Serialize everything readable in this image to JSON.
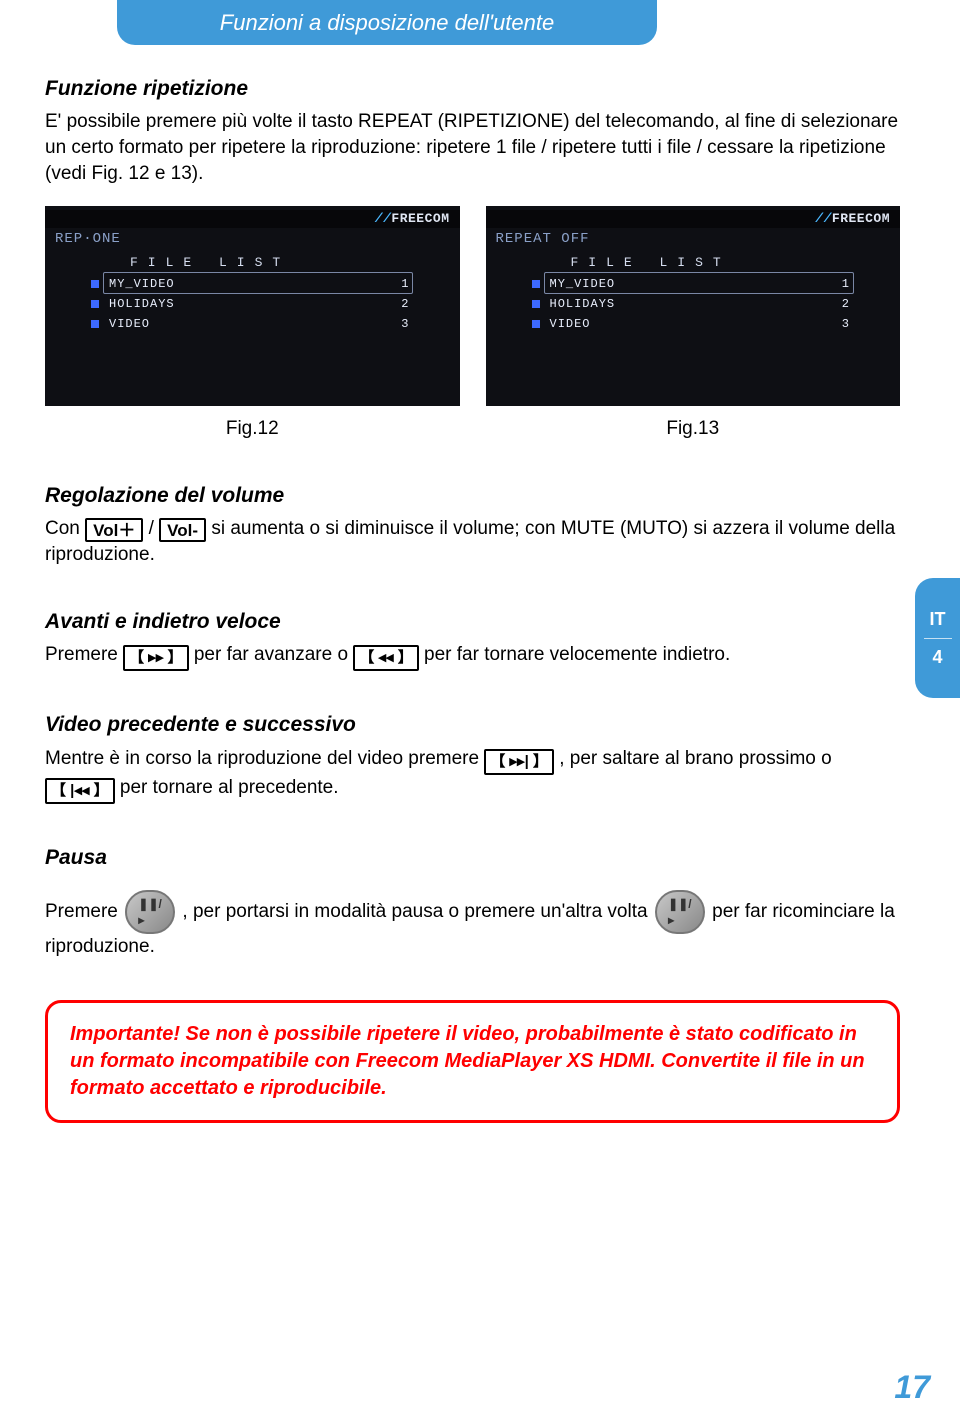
{
  "header": {
    "title": "Funzioni a disposizione dell'utente"
  },
  "sidetab": {
    "lang": "IT",
    "chapter": "4"
  },
  "sec1": {
    "heading": "Funzione ripetizione",
    "body": "E' possibile premere più volte il tasto REPEAT (RIPETIZIONE) del telecomando, al fine di selezionare un certo formato per ripetere la riproduzione: ripetere 1 file / ripetere tutti i file / cessare la ripetizione (vedi Fig. 12 e 13)."
  },
  "freecom_logo_prefix": "//",
  "freecom_logo_text": "FREECOM",
  "screen12": {
    "mode": "REP·ONE",
    "list_label": "FILE    LIST",
    "rows": [
      {
        "name": "MY_VIDEO",
        "num": "1"
      },
      {
        "name": "HOLIDAYS",
        "num": "2"
      },
      {
        "name": "VIDEO",
        "num": "3"
      }
    ],
    "caption": "Fig.12"
  },
  "screen13": {
    "mode": "REPEAT OFF",
    "list_label": "FILE    LIST",
    "rows": [
      {
        "name": "MY_VIDEO",
        "num": "1"
      },
      {
        "name": "HOLIDAYS",
        "num": "2"
      },
      {
        "name": "VIDEO",
        "num": "3"
      }
    ],
    "caption": "Fig.13"
  },
  "sec2": {
    "heading": "Regolazione del volume",
    "pre": "Con ",
    "volplus": "Vol＋",
    "mid1": " / ",
    "volminus": "Vol-",
    "post": " si aumenta o si diminuisce il volume; con MUTE (MUTO) si azzera il volume della riproduzione."
  },
  "sec3": {
    "heading": "Avanti e indietro veloce",
    "pre": "Premere ",
    "ff": "【 ▸▸ 】",
    "mid1": " per far avanzare o ",
    "rw": "【 ◂◂ 】",
    "post": " per far tornare velocemente indietro."
  },
  "sec4": {
    "heading": "Video precedente e successivo",
    "pre": "Mentre è in corso la riproduzione del video premere ",
    "next": "【 ▸▸| 】",
    "mid1": ", per saltare al brano prossimo o ",
    "prev": "【 |◂◂ 】",
    "post": " per tornare al precedente."
  },
  "sec5": {
    "heading": "Pausa",
    "pre": "Premere ",
    "pause_symbol": "❚❚/▸",
    "mid1": ", per portarsi in modalità pausa o premere un'altra volta ",
    "post": " per far ricominciare la riproduzione."
  },
  "important": {
    "title": "Importante!",
    "body": " Se non è possibile ripetere il video, probabilmente è stato codificato in un formato incompatibile con Freecom MediaPlayer XS HDMI. Convertite il file in un formato accettato e riproducibile."
  },
  "page_number": "17"
}
